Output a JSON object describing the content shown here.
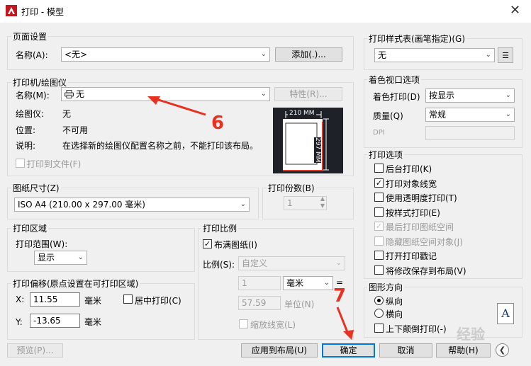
{
  "window": {
    "title": "打印 - 模型",
    "close_glyph": "✕"
  },
  "page_setup": {
    "group": "页面设置",
    "name_label": "名称(A):",
    "name_value": "<无>",
    "add_button": "添加(.)..."
  },
  "printer": {
    "group": "打印机/绘图仪",
    "name_label": "名称(M):",
    "name_value": "无",
    "properties_button": "特性(R)...",
    "plotter_label": "绘图仪:",
    "plotter_value": "无",
    "where_label": "位置:",
    "where_value": "不可用",
    "desc_label": "说明:",
    "desc_value": "在选择新的绘图仪配置名称之前，不能打印该布局。",
    "print_to_file": "打印到文件(F)",
    "preview_width": "210 MM",
    "preview_height": "297 MM"
  },
  "paper_size": {
    "group": "图纸尺寸(Z)",
    "value": "ISO A4 (210.00 x 297.00 毫米)"
  },
  "copies": {
    "group": "打印份数(B)",
    "value": "1"
  },
  "plot_area": {
    "group": "打印区域",
    "range_label": "打印范围(W):",
    "range_value": "显示"
  },
  "plot_offset": {
    "group": "打印偏移(原点设置在可打印区域)",
    "x_label": "X:",
    "x_value": "11.55",
    "y_label": "Y:",
    "y_value": "-13.65",
    "unit": "毫米",
    "center": "居中打印(C)"
  },
  "plot_scale": {
    "group": "打印比例",
    "fit": "布满图纸(I)",
    "scale_label": "比例(S):",
    "scale_value": "自定义",
    "num1": "1",
    "unit_value": "毫米",
    "eq": "=",
    "num2": "57.59",
    "unit_label": "单位(N)",
    "scale_lineweights": "缩放线宽(L)"
  },
  "style_table": {
    "group": "打印样式表(画笔指定)(G)",
    "value": "无"
  },
  "shaded": {
    "group": "着色视口选项",
    "shade_label": "着色打印(D)",
    "shade_value": "按显示",
    "quality_label": "质量(Q)",
    "quality_value": "常规",
    "dpi_label": "DPI"
  },
  "options": {
    "group": "打印选项",
    "items": [
      {
        "label": "后台打印(K)",
        "checked": false,
        "disabled": false
      },
      {
        "label": "打印对象线宽",
        "checked": true,
        "disabled": false
      },
      {
        "label": "使用透明度打印(T)",
        "checked": false,
        "disabled": false
      },
      {
        "label": "按样式打印(E)",
        "checked": false,
        "disabled": false
      },
      {
        "label": "最后打印图纸空间",
        "checked": true,
        "disabled": true
      },
      {
        "label": "隐藏图纸空间对象(J)",
        "checked": false,
        "disabled": true
      },
      {
        "label": "打开打印戳记",
        "checked": false,
        "disabled": false
      },
      {
        "label": "将修改保存到布局(V)",
        "checked": false,
        "disabled": false
      }
    ]
  },
  "orientation": {
    "group": "图形方向",
    "portrait": "纵向",
    "landscape": "横向",
    "upside_down": "上下颠倒打印(-)",
    "icon_letter": "A"
  },
  "buttons": {
    "preview": "预览(P)...",
    "apply": "应用到布局(U)",
    "ok": "确定",
    "cancel": "取消",
    "help": "帮助(H)"
  },
  "annotations": {
    "step6": "6",
    "step7": "7",
    "watermark": "经验"
  },
  "colors": {
    "accent": "#0078d7",
    "annotation": "#e8311f",
    "preview_bg": "#1e2228"
  }
}
